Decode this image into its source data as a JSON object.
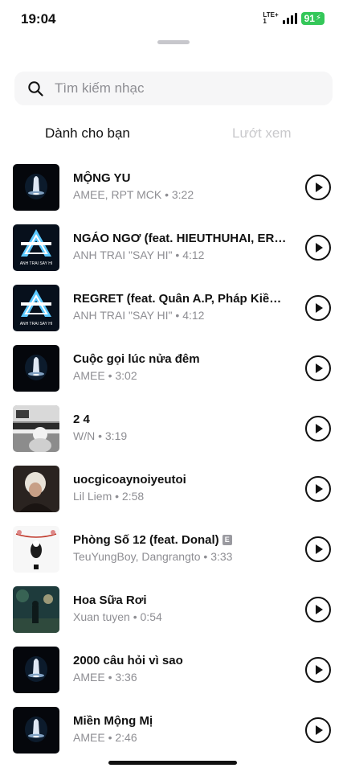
{
  "status_bar": {
    "time": "19:04",
    "network_top": "LTE+",
    "network_bottom": "1",
    "battery": "91",
    "battery_color": "#34c759"
  },
  "search": {
    "placeholder": "Tìm kiếm nhạc"
  },
  "tabs": [
    {
      "label": "Dành cho bạn",
      "active": true
    },
    {
      "label": "Lướt xem",
      "active": false
    }
  ],
  "tracks": [
    {
      "title": "MỘNG YU",
      "meta": "AMEE, RPT MCK • 3:22",
      "cover": "amee-cover"
    },
    {
      "title": "NGÁO NGƠ (feat. HIEUTHUHAI, ERIK, A...",
      "meta": "ANH TRAI \"SAY HI\" • 4:12",
      "cover": "anh-trai-say-hi-cover",
      "cover_text": "ANH TRAI SAY HI"
    },
    {
      "title": "REGRET (feat. Quân A.P, Pháp Kiều, Qu...",
      "meta": "ANH TRAI \"SAY HI\" • 4:12",
      "cover": "anh-trai-say-hi-cover",
      "cover_text": "ANH TRAI SAY HI"
    },
    {
      "title": "Cuộc gọi lúc nửa đêm",
      "meta": "AMEE • 3:02",
      "cover": "amee-cover"
    },
    {
      "title": "2 4",
      "meta": "W/N • 3:19",
      "cover": "piano-photo-cover"
    },
    {
      "title": "uocgicoaynoiyeutoi",
      "meta": "Lil Liem • 2:58",
      "cover": "portrait-cover"
    },
    {
      "title": "Phòng Số 12 (feat. Donal)",
      "explicit": "E",
      "meta": "TeuYungBoy, Dangrangto • 3:33",
      "cover": "illustration-cover"
    },
    {
      "title": "Hoa Sữa Rơi",
      "meta": "Xuan tuyen • 0:54",
      "cover": "night-street-cover"
    },
    {
      "title": "2000 câu hỏi vì sao",
      "meta": "AMEE • 3:36",
      "cover": "amee-cover"
    },
    {
      "title": "Miền Mộng Mị",
      "meta": "AMEE • 2:46",
      "cover": "amee-cover"
    }
  ]
}
